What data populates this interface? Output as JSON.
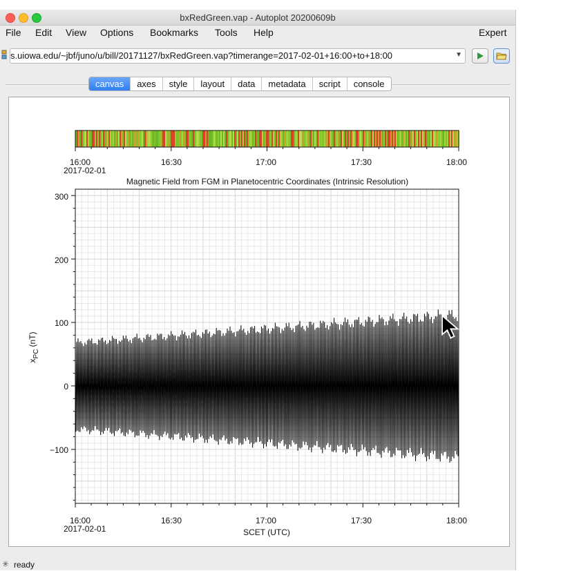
{
  "window": {
    "title": "bxRedGreen.vap - Autoplot 20200609b"
  },
  "menubar": {
    "items": [
      "File",
      "Edit",
      "View",
      "Options",
      "Bookmarks",
      "Tools",
      "Help"
    ],
    "right_item": "Expert"
  },
  "address": {
    "value": "s.uiowa.edu/~jbf/juno/u/bill/20171127/bxRedGreen.vap?timerange=2017-02-01+16:00+to+18:00"
  },
  "tabs": {
    "items": [
      "canvas",
      "axes",
      "style",
      "layout",
      "data",
      "metadata",
      "script",
      "console"
    ],
    "active": "canvas"
  },
  "status": {
    "text": "ready"
  },
  "icons": {
    "play": "play-icon",
    "open": "folder-icon",
    "dropdown": "chevron-down-icon",
    "busy": "spinner-icon"
  },
  "colors": {
    "tab_active": "#2f7ff2",
    "play_green": "#2f9a3e",
    "strip_red": "#d9432b",
    "strip_green": "#8fcf2f"
  },
  "chart_data": [
    {
      "type": "heatmap",
      "title": "",
      "x_ticks": [
        "16:00",
        "16:30",
        "17:00",
        "17:30",
        "18:00"
      ],
      "x_date": "2017-02-01",
      "colors": [
        "red",
        "green"
      ]
    },
    {
      "type": "line",
      "title": "Magnetic Field from FGM in Planetocentric Coordinates (Intrinsic Resolution)",
      "xlabel": "SCET (UTC)",
      "ylabel_main": "x",
      "ylabel_sub": "PC",
      "ylabel_unit": "(nT)",
      "x_ticks": [
        "16:00",
        "16:30",
        "17:00",
        "17:30",
        "18:00"
      ],
      "x_date": "2017-02-01",
      "xlim": [
        "16:00",
        "18:00"
      ],
      "y_ticks": [
        300,
        200,
        100,
        0,
        -100
      ],
      "y_tick_labels": [
        "300",
        "200",
        "100",
        "0",
        "−100"
      ],
      "ylim": [
        -185,
        310
      ],
      "grid": true,
      "envelope": {
        "time": [
          "16:00",
          "18:00"
        ],
        "upper": [
          68,
          112
        ],
        "lower": [
          -68,
          -113
        ]
      }
    }
  ]
}
